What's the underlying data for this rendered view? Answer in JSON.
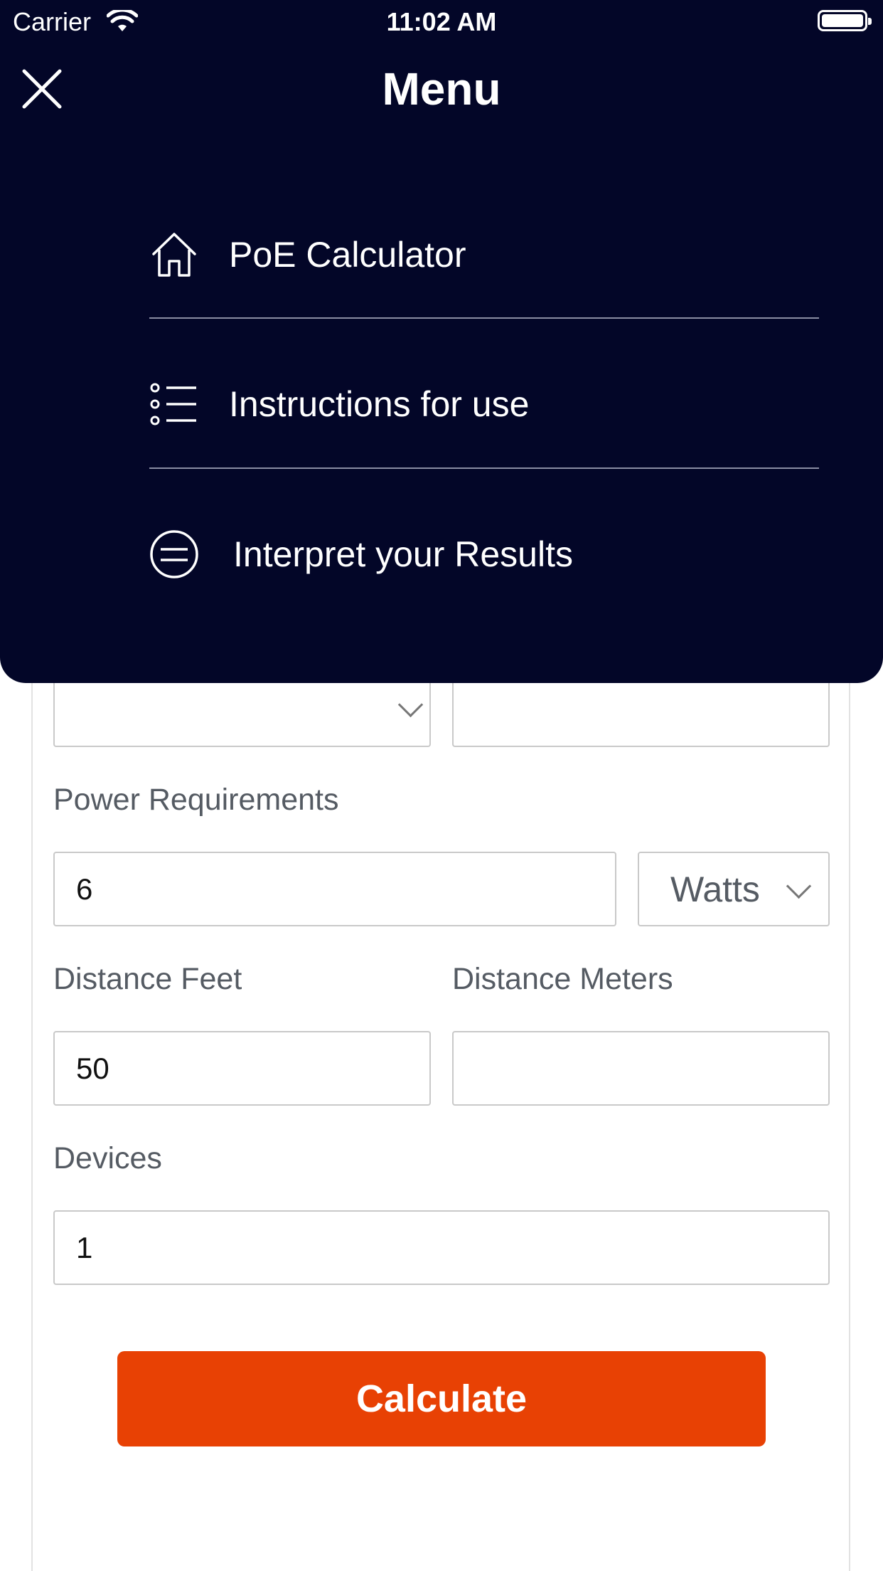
{
  "status_bar": {
    "carrier": "Carrier",
    "time": "11:02 AM"
  },
  "menu": {
    "title": "Menu",
    "items": [
      {
        "label": "PoE Calculator",
        "icon": "home-icon"
      },
      {
        "label": "Instructions for use",
        "icon": "list-icon"
      },
      {
        "label": "Interpret your Results",
        "icon": "circle-equals-icon"
      }
    ]
  },
  "form": {
    "power_requirements_label": "Power Requirements",
    "power_value": "6",
    "power_unit": "Watts",
    "distance_feet_label": "Distance Feet",
    "distance_feet_value": "50",
    "distance_meters_label": "Distance Meters",
    "distance_meters_value": "",
    "devices_label": "Devices",
    "devices_value": "1",
    "calculate_label": "Calculate"
  },
  "colors": {
    "menu_background": "#030628",
    "calculate_button": "#e84104"
  }
}
